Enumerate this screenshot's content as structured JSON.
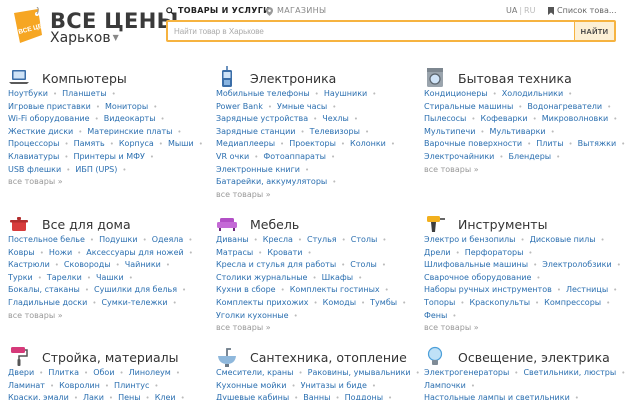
{
  "header": {
    "logo_tag": "ВСЕ ЦЕНЫ",
    "logo_title": "ВСЕ ЦЕНЫ",
    "city": "Харьков",
    "tab_goods": "ТОВАРЫ И УСЛУГИ",
    "tab_shops": "МАГАЗИНЫ",
    "lang_ua": "UA",
    "lang_ru": "RU",
    "favorites": "Список това...",
    "search_placeholder": "Найти товар в Харькове",
    "search_button": "НАЙТИ",
    "accent_color": "#f6b340"
  },
  "more_label": "все товары »",
  "categories": [
    {
      "icon": "laptop-icon",
      "title": "Компьютеры",
      "rows": [
        [
          "Ноутбуки",
          "Планшеты"
        ],
        [
          "Игровые приставки",
          "Мониторы"
        ],
        [
          "Wi-Fi оборудование",
          "Видеокарты"
        ],
        [
          "Жесткие диски",
          "Материнские платы"
        ],
        [
          "Процессоры",
          "Память",
          "Корпуса",
          "Мыши"
        ],
        [
          "Клавиатуры",
          "Принтеры и МФУ"
        ],
        [
          "USB флешки",
          "ИБП (UPS)"
        ]
      ]
    },
    {
      "icon": "phone-icon",
      "title": "Электроника",
      "rows": [
        [
          "Мобильные телефоны",
          "Наушники"
        ],
        [
          "Power Bank",
          "Умные часы"
        ],
        [
          "Зарядные устройства",
          "Чехлы"
        ],
        [
          "Зарядные станции",
          "Телевизоры"
        ],
        [
          "Медиаплееры",
          "Проекторы",
          "Колонки"
        ],
        [
          "VR очки",
          "Фотоаппараты"
        ],
        [
          "Электронные книги"
        ],
        [
          "Батарейки, аккумуляторы"
        ]
      ]
    },
    {
      "icon": "washing-machine-icon",
      "title": "Бытовая техника",
      "rows": [
        [
          "Кондиционеры",
          "Холодильники"
        ],
        [
          "Стиральные машины",
          "Водонагреватели"
        ],
        [
          "Пылесосы",
          "Кофеварки",
          "Микроволновки"
        ],
        [
          "Мультипечи",
          "Мультиварки"
        ],
        [
          "Варочные поверхности",
          "Плиты",
          "Вытяжки"
        ],
        [
          "Электрочайники",
          "Блендеры"
        ]
      ]
    },
    {
      "icon": "pot-icon",
      "title": "Все для дома",
      "rows": [
        [
          "Постельное белье",
          "Подушки",
          "Одеяла"
        ],
        [
          "Ковры",
          "Ножи",
          "Аксессуары для ножей"
        ],
        [
          "Кастрюли",
          "Сковороды",
          "Чайники"
        ],
        [
          "Турки",
          "Тарелки",
          "Чашки"
        ],
        [
          "Бокалы, стаканы",
          "Сушилки для белья"
        ],
        [
          "Гладильные доски",
          "Сумки-тележки"
        ]
      ]
    },
    {
      "icon": "sofa-icon",
      "title": "Мебель",
      "rows": [
        [
          "Диваны",
          "Кресла",
          "Стулья",
          "Столы"
        ],
        [
          "Матрасы",
          "Кровати"
        ],
        [
          "Кресла и стулья для работы",
          "Столы"
        ],
        [
          "Столики журнальные",
          "Шкафы"
        ],
        [
          "Кухни в сборе",
          "Комплекты гостиных"
        ],
        [
          "Комплекты прихожих",
          "Комоды",
          "Тумбы"
        ],
        [
          "Уголки кухонные"
        ]
      ]
    },
    {
      "icon": "drill-icon",
      "title": "Инструменты",
      "rows": [
        [
          "Электро и бензопилы",
          "Дисковые пилы"
        ],
        [
          "Дрели",
          "Перфораторы"
        ],
        [
          "Шлифовальные машины",
          "Электролобзики"
        ],
        [
          "Сварочное оборудование"
        ],
        [
          "Наборы ручных инструментов",
          "Лестницы"
        ],
        [
          "Топоры",
          "Краскопульты",
          "Компрессоры"
        ],
        [
          "Фены"
        ]
      ]
    },
    {
      "icon": "paint-roller-icon",
      "title": "Стройка, материалы",
      "rows": [
        [
          "Двери",
          "Плитка",
          "Обои",
          "Линолеум"
        ],
        [
          "Ламинат",
          "Ковролин",
          "Плинтус"
        ],
        [
          "Краски, эмали",
          "Лаки",
          "Пены",
          "Клеи"
        ]
      ]
    },
    {
      "icon": "sink-icon",
      "title": "Сантехника, отопление",
      "rows": [
        [
          "Смесители, краны",
          "Раковины, умывальники"
        ],
        [
          "Кухонные мойки",
          "Унитазы и биде"
        ],
        [
          "Душевые кабины",
          "Ванны",
          "Поддоны"
        ]
      ]
    },
    {
      "icon": "lightbulb-icon",
      "title": "Освещение, электрика",
      "rows": [
        [
          "Электрогенераторы",
          "Светильники, люстры"
        ],
        [
          "Лампочки"
        ],
        [
          "Настольные лампы и светильники"
        ]
      ]
    }
  ]
}
